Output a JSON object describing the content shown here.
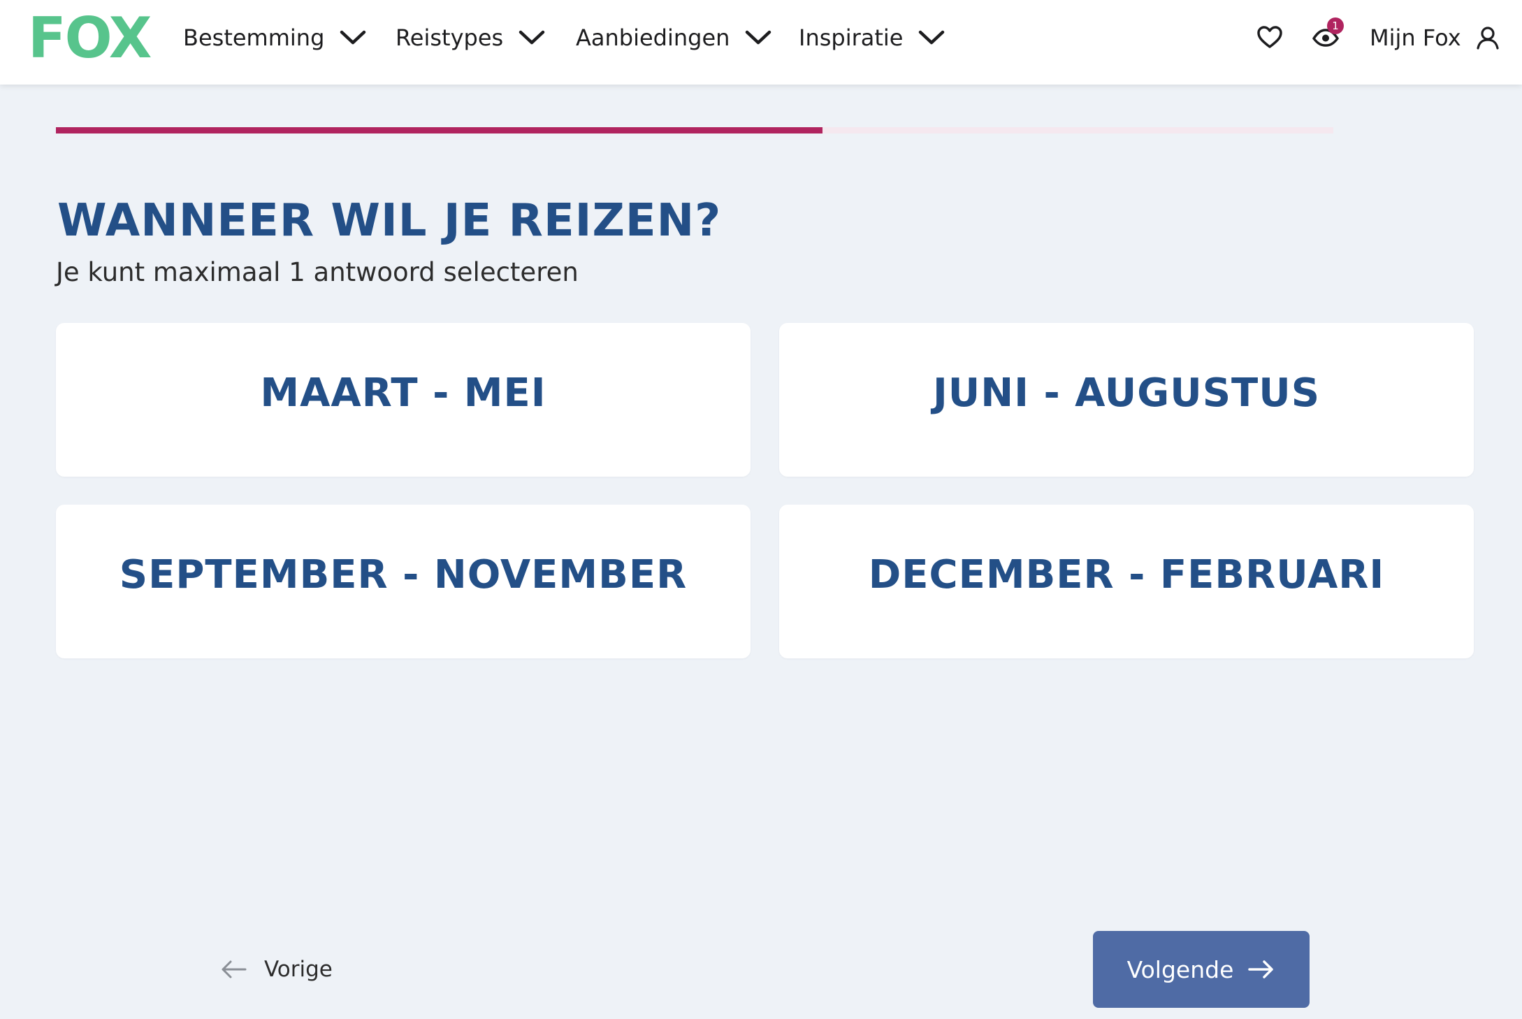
{
  "colors": {
    "brand_green": "#57c48c",
    "accent": "#b0245f",
    "heading_blue": "#234f87",
    "button_blue": "#4f6ba5",
    "page_bg": "#eef2f7"
  },
  "header": {
    "logo_text": "FOX",
    "nav": [
      {
        "label": "Bestemming",
        "icon": "chevron-down-icon"
      },
      {
        "label": "Reistypes",
        "icon": "chevron-down-icon"
      },
      {
        "label": "Aanbiedingen",
        "icon": "chevron-down-icon"
      },
      {
        "label": "Inspiratie",
        "icon": "chevron-down-icon"
      }
    ],
    "favorites_icon": "heart-icon",
    "viewed_icon": "eye-icon",
    "viewed_count": "1",
    "account_label": "Mijn Fox",
    "account_icon": "user-icon"
  },
  "quiz": {
    "progress": 0.6,
    "title": "WANNEER WIL JE REIZEN?",
    "subtitle": "Je kunt maximaal 1 antwoord selecteren",
    "options": [
      {
        "label": "MAART - MEI"
      },
      {
        "label": "JUNI - AUGUSTUS"
      },
      {
        "label": "SEPTEMBER - NOVEMBER"
      },
      {
        "label": "DECEMBER - FEBRUARI"
      }
    ]
  },
  "footer_nav": {
    "prev_label": "Vorige",
    "next_label": "Volgende"
  }
}
